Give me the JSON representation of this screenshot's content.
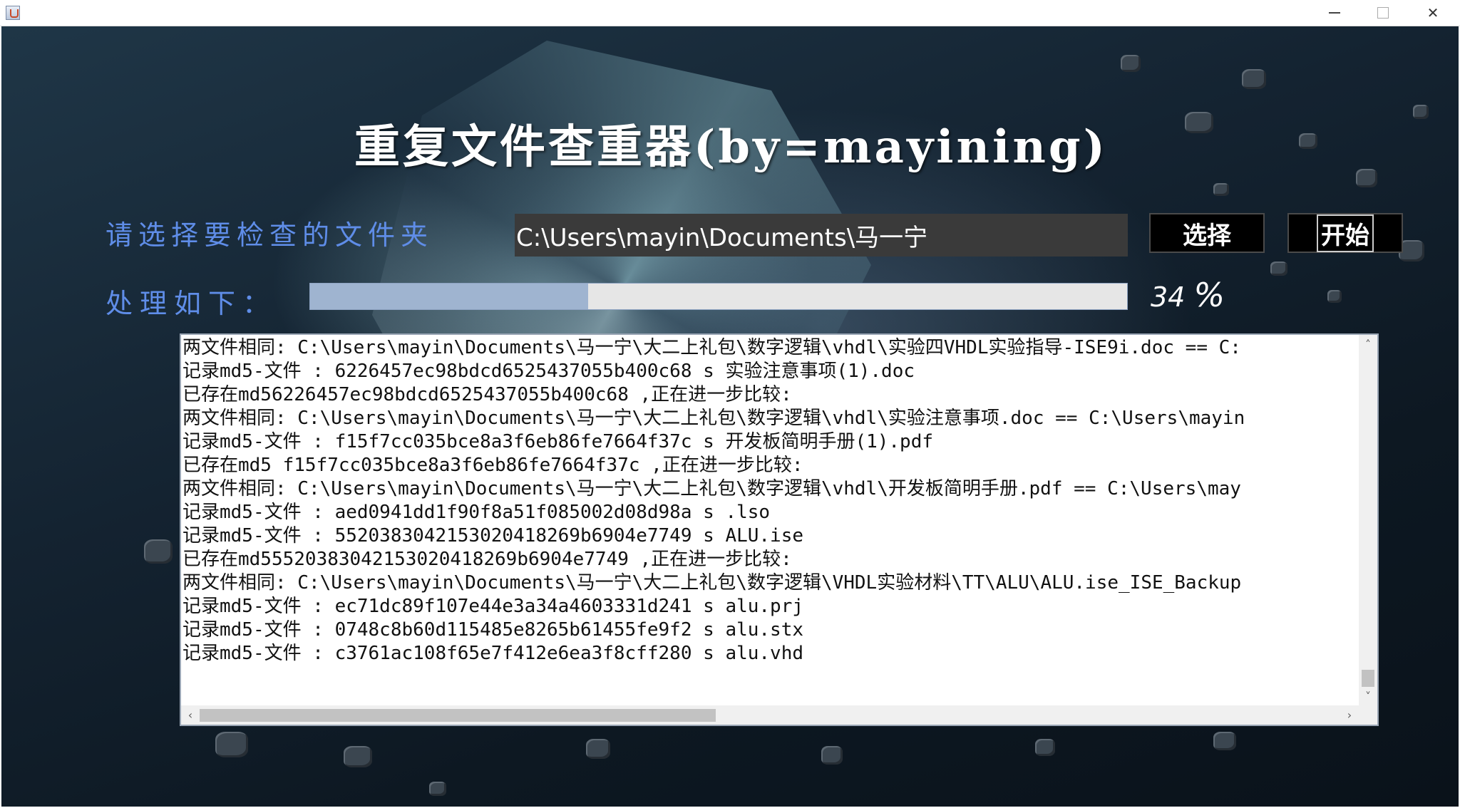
{
  "window": {
    "icon": "java-cup-icon",
    "controls": {
      "minimize": "minimize-icon",
      "maximize": "maximize-icon",
      "close": "✕"
    }
  },
  "app": {
    "title": "重复文件查重器(by=mayining)",
    "folder_label": "请选择要检查的文件夹",
    "folder_path": "C:\\Users\\mayin\\Documents\\马一宁",
    "select_button": "选择",
    "start_button": "开始",
    "process_label": "处理如下：",
    "progress_percent": 34,
    "progress_number": "34",
    "progress_unit": "%"
  },
  "log": {
    "lines": [
      "两文件相同: C:\\Users\\mayin\\Documents\\马一宁\\大二上礼包\\数字逻辑\\vhdl\\实验四VHDL实验指导-ISE9i.doc == C:",
      "记录md5-文件 : 6226457ec98bdcd6525437055b400c68 s 实验注意事项(1).doc",
      "已存在md5 6226457ec98bdcd6525437055b400c68 ,正在进一步比较:",
      "两文件相同: C:\\Users\\mayin\\Documents\\马一宁\\大二上礼包\\数字逻辑\\vhdl\\实验注意事项.doc == C:\\Users\\mayin",
      "记录md5-文件 : f15f7cc035bce8a3f6eb86fe7664f37c s 开发板简明手册(1).pdf",
      "已存在md5 f15f7cc035bce8a3f6eb86fe7664f37c ,正在进一步比较:",
      "两文件相同: C:\\Users\\mayin\\Documents\\马一宁\\大二上礼包\\数字逻辑\\vhdl\\开发板简明手册.pdf == C:\\Users\\may",
      "记录md5-文件 : aed0941dd1f90f8a51f085002d08d98a s .lso",
      "记录md5-文件 : 55203830421530204182 69b6904e7749 s ALU.ise",
      "已存在md5 552038304215302041826 9b6904e7749 ,正在进一步比较:",
      "两文件相同: C:\\Users\\mayin\\Documents\\马一宁\\大二上礼包\\数字逻辑\\VHDL实验材料\\TT\\ALU\\ALU.ise_ISE_Backup",
      "记录md5-文件 : ec71dc89f107e44e3a34a4603331d241 s alu.prj",
      "记录md5-文件 : 0748c8b60d115485e8265b61455fe9f2 s alu.stx",
      "记录md5-文件 : c3761ac108f65e7f412e6ea3f8cff280 s alu.vhd"
    ],
    "scroll_up": "˄",
    "scroll_down": "˅",
    "scroll_left": "‹",
    "scroll_right": "›"
  }
}
